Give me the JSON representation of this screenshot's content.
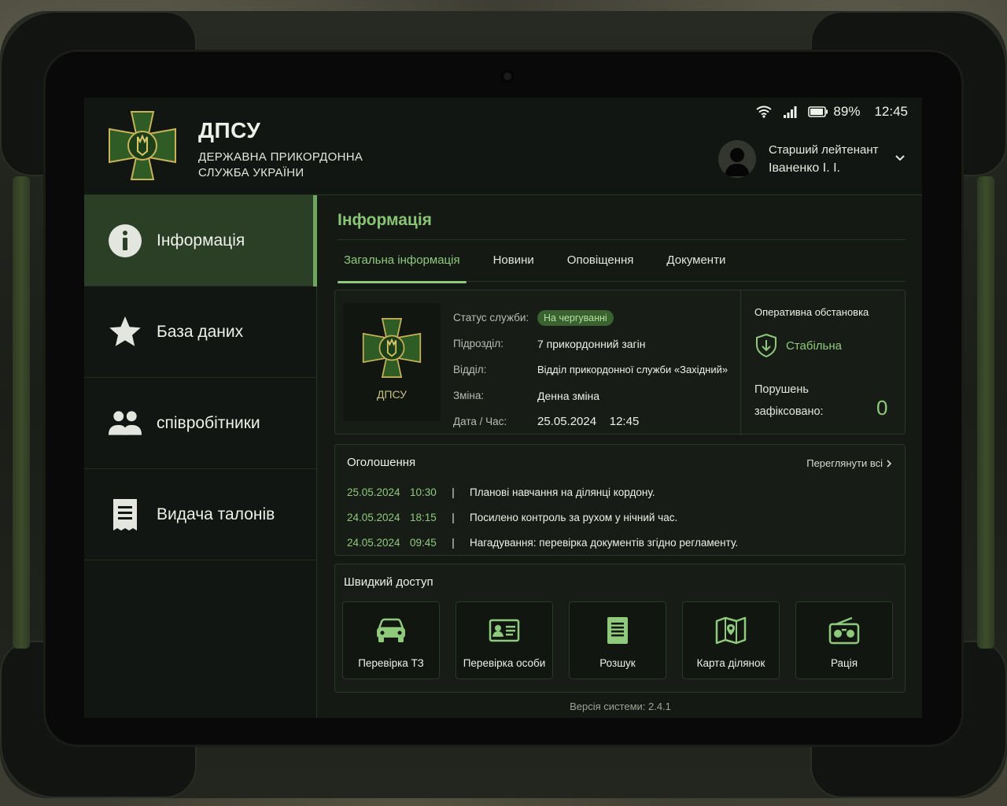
{
  "status_bar": {
    "battery": "89%",
    "time": "12:45"
  },
  "header": {
    "title": "ДПСУ",
    "subtitle_line1": "ДЕРЖАВНА ПРИКОРДОННА",
    "subtitle_line2": "СЛУЖБА УКРАЇНИ"
  },
  "user": {
    "rank": "Старший лейтенант",
    "name": "Іваненко І. І."
  },
  "sidebar": {
    "items": [
      {
        "label": "Інформація",
        "icon": "info-icon",
        "active": true
      },
      {
        "label": "База даних",
        "icon": "star-icon",
        "active": false
      },
      {
        "label": "співробітники",
        "icon": "people-icon",
        "active": false
      },
      {
        "label": "Видача талонів",
        "icon": "receipt-icon",
        "active": false
      }
    ]
  },
  "main": {
    "title": "Інформація",
    "tabs": [
      {
        "label": "Загальна інформація",
        "active": true
      },
      {
        "label": "Новини",
        "active": false
      },
      {
        "label": "Оповіщення",
        "active": false
      },
      {
        "label": "Документи",
        "active": false
      }
    ],
    "info": {
      "emblem_label": "ДПСУ",
      "rows": [
        {
          "key": "Статус служби:",
          "value": "На чергуванні",
          "badge": true
        },
        {
          "key": "Підрозділ:",
          "value": "7 прикордонний загін"
        },
        {
          "key": "Відділ:",
          "value": "Відділ прикордонної служби «Західний»"
        },
        {
          "key": "Зміна:",
          "value": "Денна зміна"
        },
        {
          "key": "Дата / Час:",
          "value": "25.05.2024    12:45"
        }
      ]
    },
    "operational": {
      "title": "Оперативна обстановка",
      "status": "Стабільна",
      "violations_line1": "Порушень",
      "violations_line2": "зафіксовано:",
      "violations_count": "0"
    },
    "announcements": {
      "title": "Оголошення",
      "view_all": "Переглянути всі",
      "items": [
        {
          "date": "25.05.2024",
          "time": "10:30",
          "sep": "|",
          "text": "Планові навчання на ділянці кордону."
        },
        {
          "date": "24.05.2024",
          "time": "18:15",
          "sep": "|",
          "text": "Посилено контроль за рухом у нічний час."
        },
        {
          "date": "24.05.2024",
          "time": "09:45",
          "sep": "|",
          "text": "Нагадування: перевірка документів згідно регламенту."
        }
      ]
    },
    "quick_access": {
      "title": "Швидкий доступ",
      "items": [
        {
          "label": "Перевірка ТЗ",
          "icon": "car-icon"
        },
        {
          "label": "Перевірка особи",
          "icon": "id-card-icon"
        },
        {
          "label": "Розшук",
          "icon": "document-icon"
        },
        {
          "label": "Карта ділянок",
          "icon": "map-icon"
        },
        {
          "label": "Рація",
          "icon": "radio-icon"
        }
      ]
    },
    "version": "Версія системи: 2.4.1"
  },
  "colors": {
    "accent": "#8fc97c",
    "active_bg": "#2b3f26",
    "badge_bg": "#3a6230",
    "gold": "#c8b25a"
  }
}
